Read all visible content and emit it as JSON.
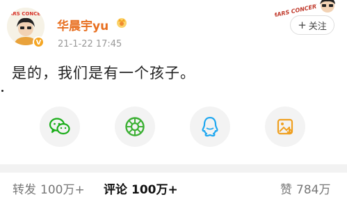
{
  "author": {
    "name": "华晨宇yu",
    "timestamp": "21-1-22 17:45",
    "avatar_text": "MARS CONCERT",
    "verified_icon": "verified-badge-icon",
    "crown_icon": "crown-badge-icon"
  },
  "corner": {
    "logo_text": "MARS CONCERT"
  },
  "follow_button": {
    "plus": "+",
    "label": "关注"
  },
  "post": {
    "text": "是的，我们是有一个孩子。"
  },
  "share_buttons": [
    {
      "name": "wechat",
      "icon": "wechat-icon",
      "color": "#1aad19"
    },
    {
      "name": "moments",
      "icon": "moments-icon",
      "color": "#3cb034"
    },
    {
      "name": "qq",
      "icon": "qq-icon",
      "color": "#1ea7f0"
    },
    {
      "name": "save-image",
      "icon": "image-save-icon",
      "color": "#f0a020"
    }
  ],
  "tabs": {
    "repost": {
      "label": "转发",
      "count": "100万+"
    },
    "comment": {
      "label": "评论",
      "count": "100万+"
    },
    "like": {
      "label": "赞",
      "count": "784万"
    }
  },
  "colors": {
    "username": "#e86f20",
    "verified": "#f5a623",
    "divider": "#f2f2f2"
  }
}
